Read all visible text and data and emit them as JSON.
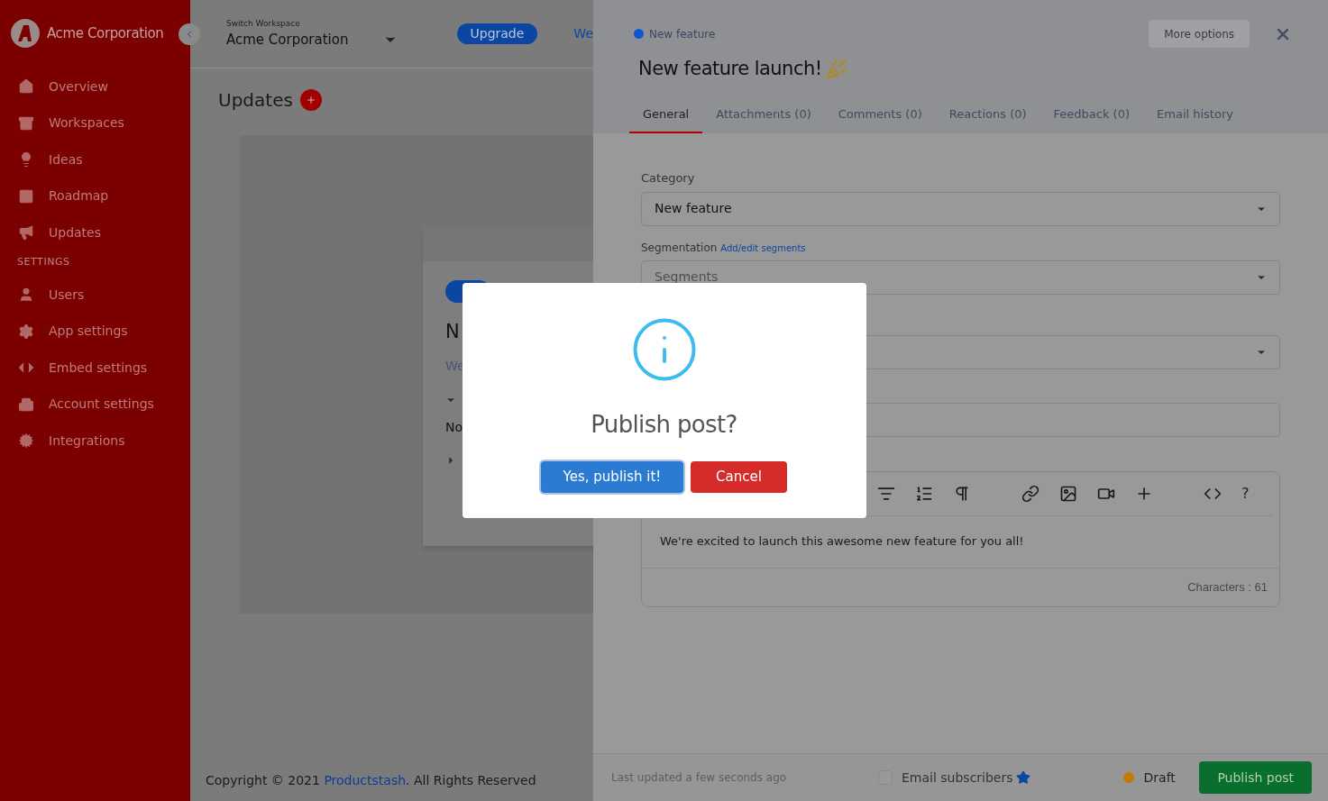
{
  "sidebar": {
    "brand": "Acme Corporation",
    "items": [
      {
        "kind": "home",
        "label": "Overview"
      },
      {
        "kind": "archive",
        "label": "Workspaces"
      },
      {
        "kind": "bulb",
        "label": "Ideas"
      },
      {
        "kind": "columns",
        "label": "Roadmap"
      },
      {
        "kind": "megaphone",
        "label": "Updates"
      }
    ],
    "section": "SETTINGS",
    "settings_items": [
      {
        "kind": "user",
        "label": "Users"
      },
      {
        "kind": "gear",
        "label": "App settings"
      },
      {
        "kind": "code",
        "label": "Embed settings"
      },
      {
        "kind": "building",
        "label": "Account settings"
      },
      {
        "kind": "plug",
        "label": "Integrations"
      }
    ]
  },
  "header": {
    "switch_label": "Switch Workspace",
    "workspace": "Acme Corporation",
    "upgrade": "Upgrade",
    "link": "We"
  },
  "page": {
    "title": "Updates",
    "card": {
      "title": "N",
      "text": "We",
      "row": "No"
    }
  },
  "footer": {
    "prefix": "Copyright © 2021 ",
    "link": "Productstash",
    "suffix": ". All Rights Reserved"
  },
  "panel": {
    "category_badge": {
      "label": "New feature",
      "color": "#0b57d0"
    },
    "more_options": "More options",
    "title": "New feature launch!",
    "tabs": [
      {
        "label": "General",
        "selected": true
      },
      {
        "label": "Attachments (0)",
        "selected": false
      },
      {
        "label": "Comments (0)",
        "selected": false
      },
      {
        "label": "Reactions (0)",
        "selected": false
      },
      {
        "label": "Feedback (0)",
        "selected": false
      },
      {
        "label": "Email history",
        "selected": false
      }
    ],
    "category": {
      "label": "Category",
      "value": "New feature"
    },
    "segmentation": {
      "label": "Segmentation",
      "link": "Add/edit segments",
      "placeholder": "Segments"
    },
    "editor": {
      "text": "We're excited to launch this awesome new feature for you all!",
      "help": "?",
      "characters": "Characters : 61"
    },
    "footer": {
      "last_updated": "Last updated a few seconds ago",
      "email_subscribers": {
        "label": "Email subscribers",
        "checked": false
      },
      "status": {
        "label": "Draft",
        "color": "#c47a00"
      },
      "publish": "Publish post"
    }
  },
  "modal": {
    "title": "Publish post?",
    "confirm": "Yes, publish it!",
    "cancel": "Cancel"
  }
}
